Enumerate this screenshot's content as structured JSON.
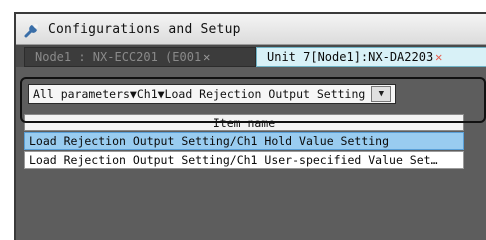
{
  "window": {
    "title": "Configurations and Setup",
    "icon": "wrench-icon"
  },
  "tabs": [
    {
      "label": "Node1 : NX-ECC201 (E001",
      "close": "✕",
      "active": false
    },
    {
      "label": "Unit 7[Node1]:NX-DA2203",
      "close": "✕",
      "active": true
    }
  ],
  "breadcrumb": {
    "text": "All parameters▼Ch1▼Load Rejection Output Setting",
    "dropdown_glyph": "▼"
  },
  "table": {
    "header": "Item name",
    "rows": [
      {
        "label": "Load Rejection Output Setting/Ch1 Hold Value Setting",
        "selected": true
      },
      {
        "label": "Load Rejection Output Setting/Ch1 User-specified Value Set…",
        "selected": false
      }
    ]
  },
  "colors": {
    "selected_row": "#99ccf0",
    "active_tab": "#d8f1f7",
    "panel": "#5d5d5d",
    "close_active": "#e65a4a"
  }
}
